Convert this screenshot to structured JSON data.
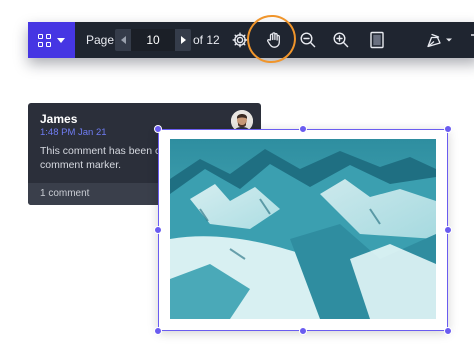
{
  "toolbar": {
    "view_switcher": {
      "icon": "grid-icon",
      "color": "#4636e3"
    },
    "page_label": "Page",
    "page_input_value": "10",
    "of_label": "of 12",
    "tools": [
      {
        "name": "settings",
        "icon": "gear-icon"
      },
      {
        "name": "pan",
        "icon": "hand-icon",
        "highlighted": true
      },
      {
        "name": "zoom-out",
        "icon": "zoom-out-icon"
      },
      {
        "name": "zoom-in",
        "icon": "zoom-in-icon"
      },
      {
        "name": "page-layout",
        "icon": "page-icon"
      },
      {
        "name": "annotate",
        "icon": "pen-tool-icon"
      }
    ],
    "highlight_color": "#f0952b"
  },
  "comment": {
    "author": "James",
    "time": "1:48 PM Jan 21",
    "body": "This comment has been created as a comment marker.",
    "count": "1 comment",
    "accent_color": "#6f7cf2"
  },
  "annotation": {
    "image": "snowy-mountains-photo",
    "selection_color": "#6a5cf0"
  }
}
